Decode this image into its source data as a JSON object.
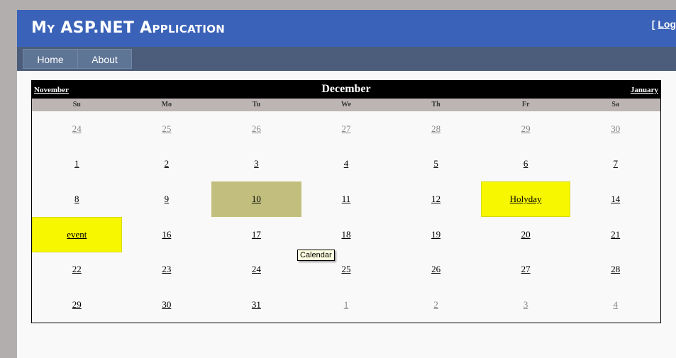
{
  "app": {
    "title": "My ASP.NET Application",
    "login_prefix": "[ ",
    "login_link": "Log"
  },
  "nav": [
    {
      "label": "Home"
    },
    {
      "label": "About"
    }
  ],
  "calendar": {
    "month": "December",
    "prev_link": "November",
    "next_link": "January",
    "day_headers": [
      "Su",
      "Mo",
      "Tu",
      "We",
      "Th",
      "Fr",
      "Sa"
    ],
    "weeks": [
      [
        {
          "label": "24",
          "other": true
        },
        {
          "label": "25",
          "other": true
        },
        {
          "label": "26",
          "other": true
        },
        {
          "label": "27",
          "other": true
        },
        {
          "label": "28",
          "other": true
        },
        {
          "label": "29",
          "other": true
        },
        {
          "label": "30",
          "other": true
        }
      ],
      [
        {
          "label": "1"
        },
        {
          "label": "2"
        },
        {
          "label": "3"
        },
        {
          "label": "4"
        },
        {
          "label": "5"
        },
        {
          "label": "6"
        },
        {
          "label": "7"
        }
      ],
      [
        {
          "label": "8"
        },
        {
          "label": "9"
        },
        {
          "label": "10",
          "selected": true
        },
        {
          "label": "11"
        },
        {
          "label": "12"
        },
        {
          "label": "Holyday",
          "event": true
        },
        {
          "label": "14"
        }
      ],
      [
        {
          "label": "event",
          "event": true
        },
        {
          "label": "16"
        },
        {
          "label": "17"
        },
        {
          "label": "18"
        },
        {
          "label": "19"
        },
        {
          "label": "20"
        },
        {
          "label": "21"
        }
      ],
      [
        {
          "label": "22"
        },
        {
          "label": "23"
        },
        {
          "label": "24"
        },
        {
          "label": "25"
        },
        {
          "label": "26"
        },
        {
          "label": "27"
        },
        {
          "label": "28"
        }
      ],
      [
        {
          "label": "29"
        },
        {
          "label": "30"
        },
        {
          "label": "31"
        },
        {
          "label": "1",
          "other": true
        },
        {
          "label": "2",
          "other": true
        },
        {
          "label": "3",
          "other": true
        },
        {
          "label": "4",
          "other": true
        }
      ]
    ]
  },
  "tooltip": "Calendar",
  "colors": {
    "header": "#3a62b8",
    "nav": "#4b5d7a",
    "selected_day": "#c2bf7e",
    "event_day": "#f7f700"
  }
}
